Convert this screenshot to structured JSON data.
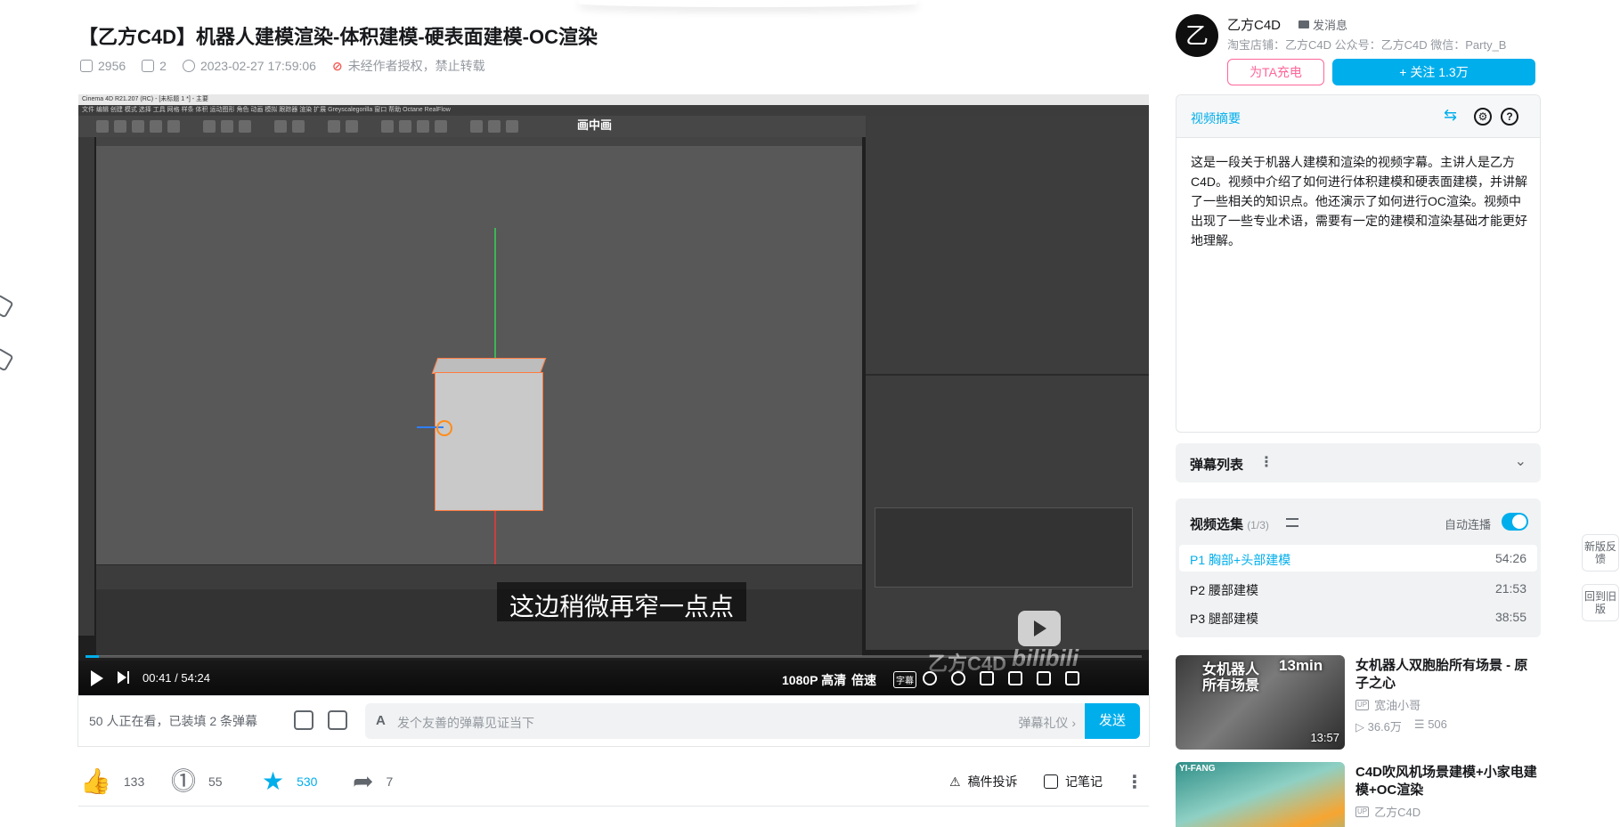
{
  "video": {
    "title": "【乙方C4D】机器人建模渲染-体积建模-硬表面建模-OC渲染",
    "views": "2956",
    "danmaku_count": "2",
    "datetime": "2023-02-27 17:59:06",
    "copyright_notice": "未经作者授权，禁止转载"
  },
  "player": {
    "subtitle": "这边稍微再窄一点点",
    "pip_label": "画中画",
    "current_time": "00:41",
    "separator": "/",
    "total_time": "54:24",
    "progress_fraction": 0.0126,
    "quality_label": "1080P 高清",
    "speed_label": "倍速",
    "cc_label": "字幕",
    "watermark": "乙方C4D",
    "watermark_logo": "bilibili",
    "c4d_title": "Cinema 4D R21.207 (RC) - [未标题 1 *] - 主要",
    "c4d_menu": "文件  编辑  创建  模式  选择  工具  网格  样条  体积  运动图形  角色  动画  模拟  跟踪器  渲染  扩展  Greyscalegorilla  窗口  帮助  Octane  RealFlow"
  },
  "danmaku_bar": {
    "watching": "50 人正在看，已装填 2 条弹幕",
    "input_icon": "A",
    "placeholder": "发个友善的弹幕见证当下",
    "etiquette": "弹幕礼仪 ›",
    "send_label": "发送"
  },
  "actions": {
    "like_count": "133",
    "coin_count": "55",
    "favorite_count": "530",
    "share_count": "7",
    "report_label": "稿件投诉",
    "notes_label": "记笔记"
  },
  "uploader": {
    "avatar_glyph": "乙",
    "name": "乙方C4D",
    "message_label": "发消息",
    "description": "淘宝店铺：乙方C4D 公众号：乙方C4D 微信：Party_B",
    "charge_label": "为TA充电",
    "follow_label": "+ 关注 1.3万"
  },
  "summary": {
    "title": "视频摘要",
    "swap_icon": "⇆",
    "settings_icon": "⚙",
    "help_icon": "?",
    "text": "这是一段关于机器人建模和渲染的视频字幕。主讲人是乙方C4D。视频中介绍了如何进行体积建模和硬表面建模，并讲解了一些相关的知识点。他还演示了如何进行OC渲染。视频中出现了一些专业术语，需要有一定的建模和渲染基础才能更好地理解。"
  },
  "danmaku_list": {
    "title": "弹幕列表",
    "kebab": "⋮",
    "chevron": "⌄"
  },
  "episodes": {
    "title": "视频选集",
    "count": "(1/3)",
    "autoplay_label": "自动连播",
    "items": [
      {
        "label": "P1  胸部+头部建模",
        "duration": "54:26"
      },
      {
        "label": "P2  腰部建模",
        "duration": "21:53"
      },
      {
        "label": "P3  腿部建模",
        "duration": "38:55"
      }
    ]
  },
  "recommendations": [
    {
      "title": "女机器人双胞胎所有场景 - 原子之心",
      "uploader": "宽油小哥",
      "views": "36.6万",
      "danmaku": "506",
      "duration": "13:57",
      "thumb_text": "女机器人\n所有场景",
      "thumb_min": "13min"
    },
    {
      "title": "C4D吹风机场景建模+小家电建模+OC渲染",
      "uploader": "乙方C4D",
      "thumb_brand": "YI-FANG"
    }
  ],
  "side_float": {
    "new_feedback": "新版反馈",
    "back_old": "回到旧版"
  },
  "colors": {
    "accent": "#00aeec",
    "charge_pink": "#ff6699",
    "text_primary": "#18191c",
    "text_secondary": "#9499a0"
  }
}
